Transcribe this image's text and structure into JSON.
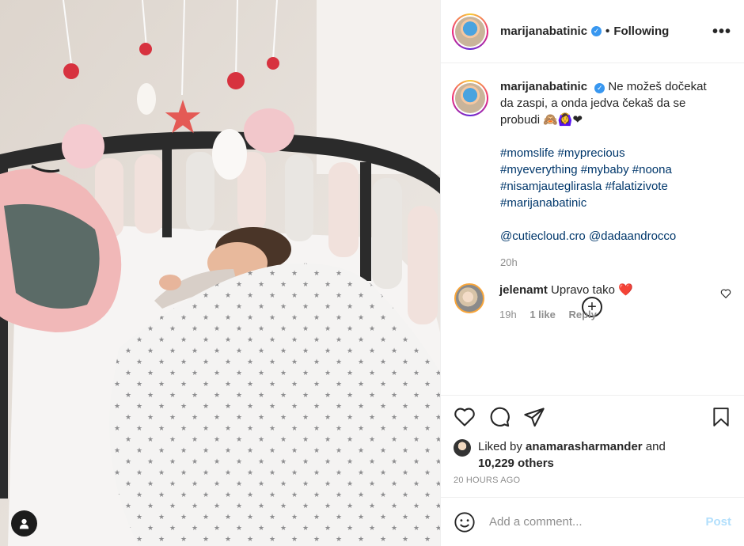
{
  "header": {
    "username": "marijanabatinic",
    "separator": "•",
    "follow_state": "Following",
    "more_label": "•••"
  },
  "caption": {
    "username": "marijanabatinic",
    "text": "Ne možeš dočekat da zaspi, a onda jedva čekaš da se probudi 🙈🙆‍♀️❤",
    "hashtags": [
      "#momslife",
      "#myprecious",
      "#myeverything",
      "#mybaby",
      "#noona",
      "#nisamjauteglirasla",
      "#falatizivote",
      "#marijanabatinic"
    ],
    "mentions": [
      "@cutiecloud.cro",
      "@dadaandrocco"
    ],
    "time": "20h"
  },
  "load_more_label": "+",
  "comment": {
    "username": "jelenamt",
    "text": "Upravo tako",
    "emoji": "❤️",
    "time": "19h",
    "likes": "1 like",
    "reply": "Reply"
  },
  "likes": {
    "prefix": "Liked by",
    "user": "anamarasharmander",
    "connector": "and",
    "others": "10,229 others"
  },
  "timestamp": "20 HOURS AGO",
  "add_comment": {
    "placeholder": "Add a comment...",
    "post_label": "Post"
  },
  "icons": [
    "user-tag-icon",
    "verified-icon",
    "more-icon",
    "load-more-icon",
    "heart-icon",
    "like-icon",
    "comment-icon",
    "share-icon",
    "save-icon",
    "emoji-icon"
  ]
}
